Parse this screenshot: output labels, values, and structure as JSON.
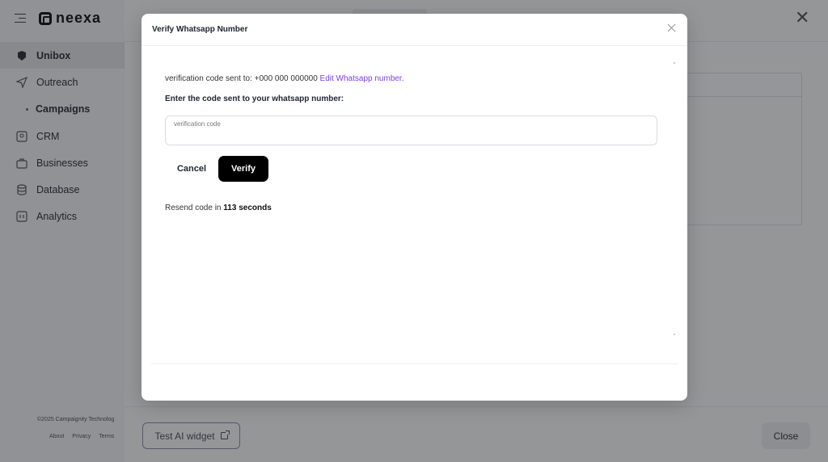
{
  "sidebar": {
    "logo": "neexa",
    "items": [
      {
        "label": "Unibox",
        "icon": "unibox-icon",
        "active": true
      },
      {
        "label": "Outreach",
        "icon": "send-icon"
      },
      {
        "label": "Campaigns",
        "icon": "dot-icon",
        "sub": true
      },
      {
        "label": "CRM",
        "icon": "crm-icon"
      },
      {
        "label": "Businesses",
        "icon": "business-icon"
      },
      {
        "label": "Database",
        "icon": "database-icon"
      },
      {
        "label": "Analytics",
        "icon": "analytics-icon"
      }
    ],
    "footer": "©2025 Campaignity Technolog",
    "links": [
      "About",
      "Privacy",
      "Terms"
    ]
  },
  "drawer": {
    "test_button": "Test AI widget",
    "close_button": "Close"
  },
  "modal": {
    "title": "Verify Whatsapp Number",
    "sent_prefix": "verification code sent to:",
    "phone": "+000 000 000000",
    "edit_link": "Edit Whatsapp number.",
    "enter_label": "Enter the code sent to your whatsapp number:",
    "code_label": "verification code",
    "code_value": "",
    "cancel": "Cancel",
    "verify": "Verify",
    "resend_prefix": "Resend code in",
    "resend_time": "113 seconds"
  },
  "colors": {
    "accent_link": "#7b3fe4",
    "primary_button": "#000000",
    "overlay": "rgba(20,22,26,0.45)"
  }
}
